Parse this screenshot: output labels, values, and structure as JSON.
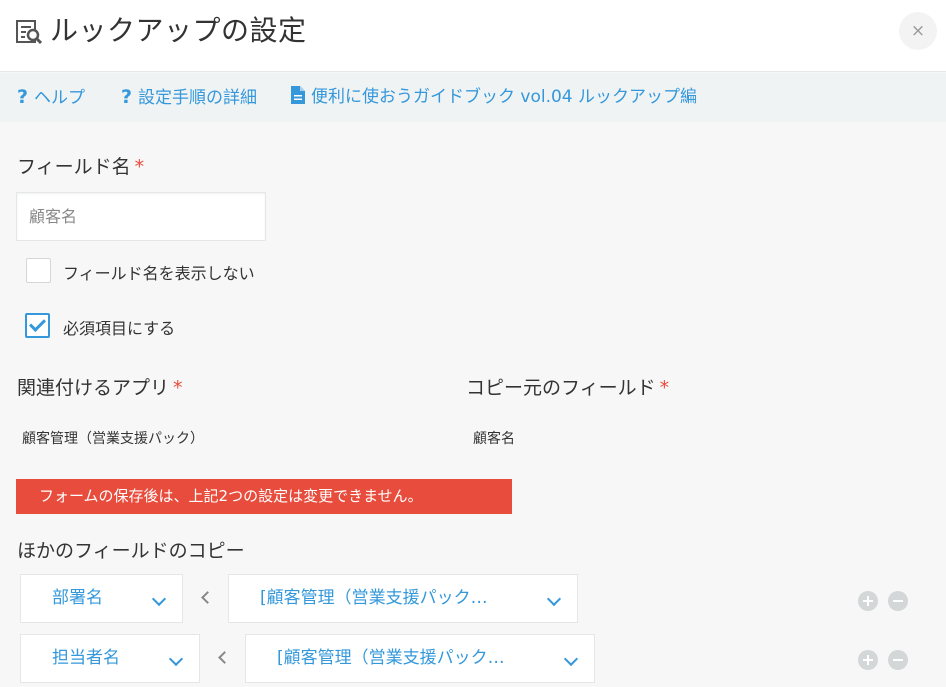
{
  "header": {
    "title": "ルックアップの設定",
    "close_symbol": "×"
  },
  "helpbar": {
    "help_label": "ヘルプ",
    "steps_label": "設定手順の詳細",
    "guide_label": "便利に使おうガイドブック vol.04 ルックアップ編",
    "question_symbol": "?"
  },
  "field_name": {
    "label": "フィールド名",
    "required_mark": "*",
    "value": "顧客名"
  },
  "options": {
    "hide_label": "フィールド名を表示しない",
    "hide_checked": false,
    "required_label": "必須項目にする",
    "required_checked": true
  },
  "related_app": {
    "label": "関連付けるアプリ",
    "required_mark": "*",
    "value": "顧客管理（営業支援パック）"
  },
  "copy_source": {
    "label": "コピー元のフィールド",
    "required_mark": "*",
    "value": "顧客名"
  },
  "warning_text": "フォームの保存後は、上記2つの設定は変更できません。",
  "other_copy": {
    "label": "ほかのフィールドのコピー",
    "rows": [
      {
        "target": "部署名",
        "source": "[顧客管理（営業支援パック…"
      },
      {
        "target": "担当者名",
        "source": "[顧客管理（営業支援パック…"
      }
    ]
  },
  "colors": {
    "accent": "#3498db",
    "required": "#e74c3c",
    "warning_bg": "#e74c3c"
  },
  "icons": [
    "lookup-settings-icon",
    "close-icon",
    "help-icon",
    "document-icon",
    "chevron-down-icon",
    "chevron-left-icon",
    "plus-icon",
    "minus-icon"
  ]
}
